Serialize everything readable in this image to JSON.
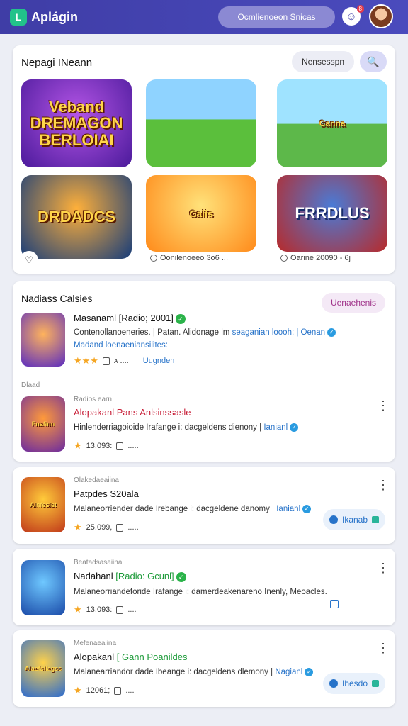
{
  "header": {
    "app_title": "Aplágin",
    "logo_icon": "logo-icon",
    "search_placeholder": "Ocmlienoeon Snicas",
    "notification_badge": "8"
  },
  "featured": {
    "title": "Nepagi INeann",
    "pill_button": "Nensesspn",
    "search_icon": "search-icon",
    "tiles": [
      {
        "art_text": "Veband DREMAGON BERLOIAI"
      },
      {
        "art_text": ""
      },
      {
        "art_text": "Canna"
      },
      {
        "art_text": "DRDADCS"
      },
      {
        "art_text": "Caiis"
      },
      {
        "art_text": "FRRDLUS"
      }
    ],
    "captions": [
      "Oonilenoeeo 3o6 ...",
      "Oarine 20090 - 6j"
    ],
    "page_dots": 5
  },
  "categories": {
    "title": "Nadiass Calsies",
    "button": "Uenaehenis",
    "top_item": {
      "name": "Masanaml [Radio; 2001]",
      "desc1": "Contenollanoeneries. | Patan. Alidonage lm",
      "desc1b": "seaganian loooh; | Oenan",
      "desc2": "Madand loenaeniansilites:",
      "meta": "ᴀ ....",
      "meta_link": "Uugnden"
    },
    "section_label": "Dlaad",
    "second_item": {
      "sub": "Radios earn",
      "name": "Alopakanl Pans Anlsinssasle",
      "desc": "Hinlenderriagoioide Irafange i: dacgeldens dienony",
      "desc_link": "Ianianl",
      "rating": "13.093:",
      "meta": "....."
    }
  },
  "list": [
    {
      "sub": "Olakedaeaiina",
      "name": "Patpdes S20ala",
      "desc": "Malaneorriender dade Irebange i: dacgeldene danomy",
      "desc_link": "Ianianl",
      "rating": "25.099,",
      "meta": ".....",
      "button": "Ikanab",
      "art": "Alnfeslet"
    },
    {
      "sub": "Beatadsasaiina",
      "name": "Nadahanl",
      "name_green": "[Radio: Gcunl]",
      "desc": "Malaneorriandeforide Irafange i: damerdeakenareno Inenly,  Meoacles.",
      "rating": "13.093:",
      "meta": "....",
      "art": ""
    },
    {
      "sub": "Mefenaeaiina",
      "name": "Alopakanl",
      "name_green": "[ Gann Poanildes",
      "desc": "Malanearriandor dade Ibeange i: dacgeldens dlemony",
      "desc_link": "Nagianl",
      "rating": "12061;",
      "meta": "....",
      "button": "Ihesdo",
      "art": "Alaefsllagss"
    }
  ]
}
